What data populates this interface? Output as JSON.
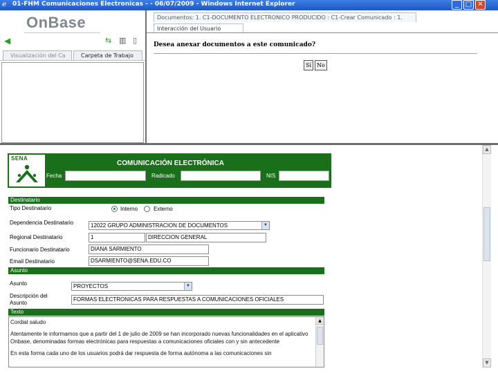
{
  "window": {
    "title": "01-FHM Comunicaciones Electronicas - - 06/07/2009 - Windows Internet Explorer",
    "icon": "ie-icon",
    "controls": [
      "minimize",
      "maximize",
      "close"
    ]
  },
  "left_pane": {
    "logo": "OnBase",
    "tabs": [
      "Visualización del Ca",
      "Carpeta de Trabajo"
    ]
  },
  "right_pane": {
    "document_tab": "Documentos: 1. C1-DOCUMENTO ELECTRONICO PRODUCIDO : C1-Crear Comunicado : 1.",
    "sub_tab": "Interacción del Usuario",
    "question": "Desea anexar documentos a este comunicado?",
    "yes_label": "Sí",
    "no_label": "No"
  },
  "form": {
    "logo_text": "SENA",
    "header_title": "COMUNICACIÓN ELECTRÓNICA",
    "fecha_label": "Fecha",
    "radicado_label": "Radicado",
    "nis_label": "NIS",
    "fecha_value": "",
    "radicado_value": "",
    "nis_value": "",
    "destinatario": {
      "section": "Destinatario",
      "tipo_label": "Tipo Destinatario",
      "option_interno": "Interno",
      "option_externo": "Externo",
      "selected": "Interno",
      "dependencia_label": "Dependencia Destinatario",
      "dependencia_value": "12022 GRUPO ADMINISTRACION DE DOCUMENTOS",
      "regional_label": "Regional Destinatario",
      "regional_code": "1",
      "regional_value": "DIRECCION GENERAL",
      "funcionario_label": "Funcionario Destinatario",
      "funcionario_value": "DIANA SARMIENTO",
      "email_label": "Email Destinatario",
      "email_value": "DSARMIENTO@SENA.EDU.CO"
    },
    "asunto": {
      "section": "Asunto",
      "asunto_label": "Asunto",
      "asunto_value": "PROYECTOS",
      "descripcion_label_1": "Descripción del",
      "descripcion_label_2": "Asunto",
      "descripcion_value": "FORMAS ELECTRONICAS PARA RESPUESTAS A COMUNICACIONES OFICIALES"
    },
    "texto": {
      "section": "Texto",
      "greeting": "Cordial saludo",
      "paragraph_1": "Atentamente le informamos que a partir del 1 de julio de 2009 se han incorporado nuevas funcionalidades en el aplicativo Onbase, denominadas formas electrónicas para respuestas a comunicaciones oficiales con y sin antecedente",
      "paragraph_2": "En esta forma cada uno de los usuarios podrá dar respuesta de forma autónoma a las comunicaciones sin"
    }
  },
  "colors": {
    "titlebar": "#1f56c6",
    "brand_green": "#1a6f1a",
    "close_button": "#d2482b"
  }
}
